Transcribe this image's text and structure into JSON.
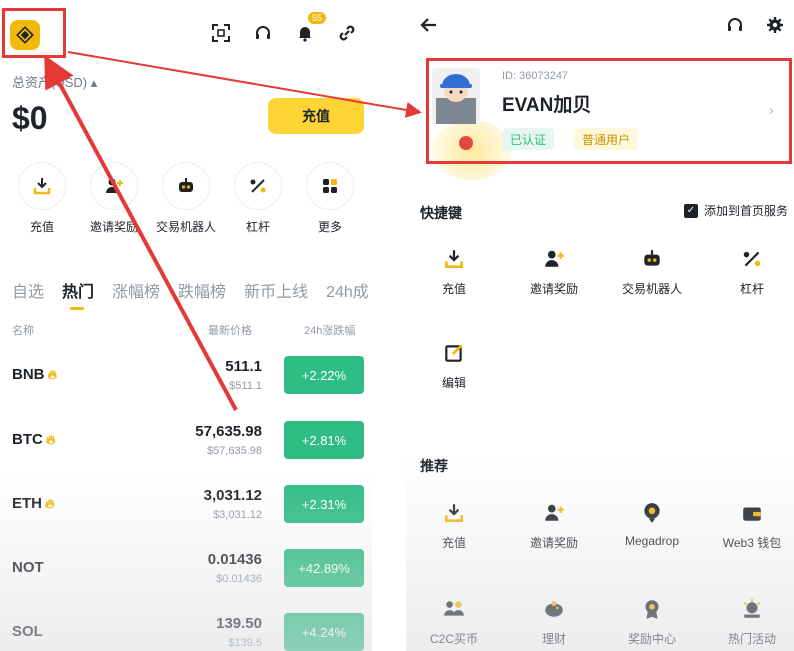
{
  "left": {
    "header_icons": [
      "scan-icon",
      "headset-icon",
      "bell-icon",
      "link-icon"
    ],
    "notification_count": "55",
    "asset_label": "总资产(USD) ▴",
    "asset_value": "$0",
    "deposit_label": "充值",
    "quick_actions": [
      {
        "icon": "deposit-icon",
        "label": "充值"
      },
      {
        "icon": "invite-icon",
        "label": "邀请奖励"
      },
      {
        "icon": "robot-icon",
        "label": "交易机器人"
      },
      {
        "icon": "leverage-icon",
        "label": "杠杆"
      },
      {
        "icon": "more-icon",
        "label": "更多"
      }
    ],
    "tabs": [
      "自选",
      "热门",
      "涨幅榜",
      "跌幅榜",
      "新币上线",
      "24h成"
    ],
    "active_tab": "热门",
    "columns": {
      "name": "名称",
      "price": "最新价格",
      "change": "24h涨跌幅"
    },
    "coins": [
      {
        "name": "BNB",
        "hot": true,
        "price": "511.1",
        "sub": "$511.1",
        "change": "+2.22%"
      },
      {
        "name": "BTC",
        "hot": true,
        "price": "57,635.98",
        "sub": "$57,635.98",
        "change": "+2.81%"
      },
      {
        "name": "ETH",
        "hot": true,
        "price": "3,031.12",
        "sub": "$3,031.12",
        "change": "+2.31%"
      },
      {
        "name": "NOT",
        "hot": false,
        "price": "0.01436",
        "sub": "$0.01436",
        "change": "+42.89%"
      },
      {
        "name": "SOL",
        "hot": false,
        "price": "139.50",
        "sub": "$139.5",
        "change": "+4.24%"
      }
    ],
    "colors": {
      "accent": "#f0b90b",
      "up": "#2ebd85"
    }
  },
  "right": {
    "profile": {
      "uid": "ID: 36073247",
      "name": "EVAN加贝",
      "verified": "已认证",
      "user_type": "普通用户"
    },
    "shortcuts_title": "快捷键",
    "add_home": "添加到首页服务",
    "shortcuts": [
      {
        "icon": "deposit-icon",
        "label": "充值"
      },
      {
        "icon": "invite-icon",
        "label": "邀请奖励"
      },
      {
        "icon": "robot-icon",
        "label": "交易机器人"
      },
      {
        "icon": "leverage-icon",
        "label": "杠杆"
      },
      {
        "icon": "edit-icon",
        "label": "编辑"
      }
    ],
    "recommend_title": "推荐",
    "recommend": [
      {
        "icon": "deposit-icon",
        "label": "充值"
      },
      {
        "icon": "invite-icon",
        "label": "邀请奖励"
      },
      {
        "icon": "megadrop-icon",
        "label": "Megadrop"
      },
      {
        "icon": "wallet-icon",
        "label": "Web3 钱包"
      },
      {
        "icon": "c2c-icon",
        "label": "C2C买币"
      },
      {
        "icon": "piggy-icon",
        "label": "理财"
      },
      {
        "icon": "reward-icon",
        "label": "奖励中心"
      },
      {
        "icon": "event-icon",
        "label": "热门活动"
      }
    ]
  }
}
